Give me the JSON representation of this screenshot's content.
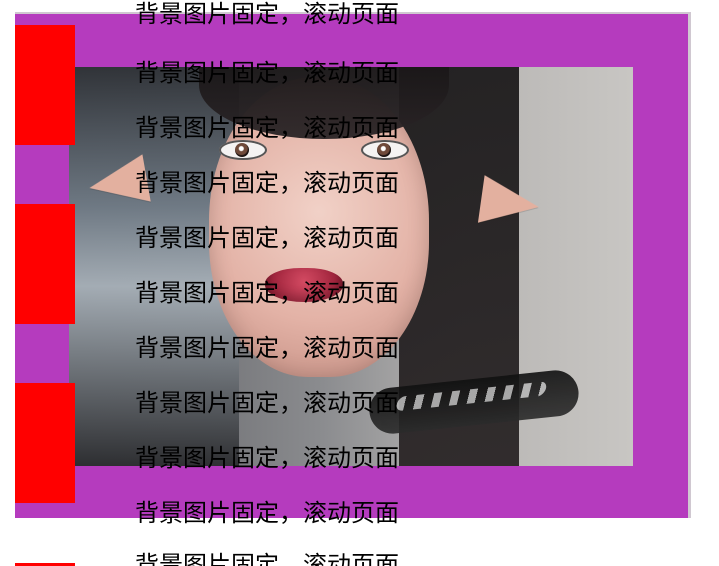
{
  "colors": {
    "background": "#ffffff",
    "purple": "#b53bbe",
    "red": "#ff0000",
    "text": "#000000"
  },
  "content": {
    "lines": [
      "背景图片固定，滚动页面",
      "背景图片固定，滚动页面",
      "背景图片固定，滚动页面",
      "背景图片固定，滚动页面",
      "背景图片固定，滚动页面",
      "背景图片固定，滚动页面",
      "背景图片固定，滚动页面",
      "背景图片固定，滚动页面",
      "背景图片固定，滚动页面",
      "背景图片固定，滚动页面",
      "背景图片固定，滚动页面"
    ]
  }
}
